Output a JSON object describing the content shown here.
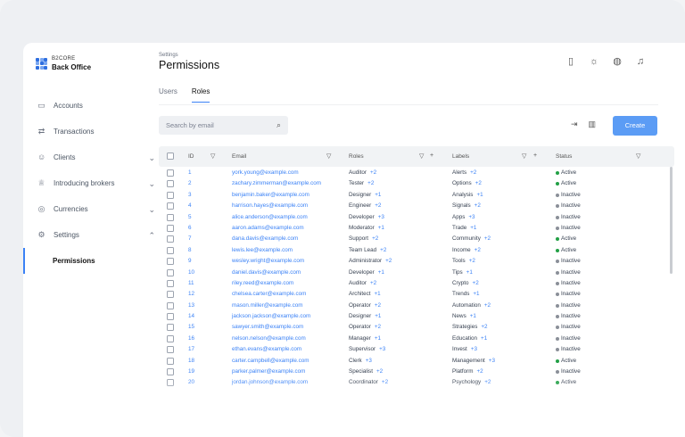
{
  "brand": {
    "line1": "B2CORE",
    "line2": "Back Office",
    "accent": "#2f6fe0"
  },
  "sidebar": {
    "items": [
      {
        "label": "Accounts",
        "icon": "wallet-icon",
        "glyph": "▭",
        "chevron": ""
      },
      {
        "label": "Transactions",
        "icon": "arrows-icon",
        "glyph": "⇄",
        "chevron": ""
      },
      {
        "label": "Clients",
        "icon": "users-icon",
        "glyph": "☺",
        "chevron": "⌄"
      },
      {
        "label": "Introducing brokers",
        "icon": "trophy-icon",
        "glyph": "♕",
        "chevron": "⌄"
      },
      {
        "label": "Currencies",
        "icon": "coin-icon",
        "glyph": "◎",
        "chevron": "⌄"
      },
      {
        "label": "Settings",
        "icon": "gear-icon",
        "glyph": "⚙",
        "chevron": "⌃"
      }
    ],
    "sub_active": "Permissions"
  },
  "header": {
    "breadcrumb": "Settings",
    "title": "Permissions",
    "icons": [
      "document-icon",
      "sun-icon",
      "globe-icon",
      "bell-icon"
    ]
  },
  "tabs": [
    {
      "label": "Users",
      "active": false
    },
    {
      "label": "Roles",
      "active": true
    }
  ],
  "search": {
    "placeholder": "Search by email"
  },
  "create_label": "Create",
  "columns": {
    "id": "ID",
    "email": "Email",
    "roles": "Roles",
    "labels": "Labels",
    "status": "Status"
  },
  "status_colors": {
    "Active": "#22a046",
    "Inactive": "#8a8f98"
  },
  "rows": [
    {
      "id": "1",
      "email": "york.young@example.com",
      "role": "Auditor",
      "role_more": "+2",
      "label": "Alerts",
      "label_more": "+2",
      "status": "Active"
    },
    {
      "id": "2",
      "email": "zachary.zimmerman@example.com",
      "role": "Tester",
      "role_more": "+2",
      "label": "Options",
      "label_more": "+2",
      "status": "Active"
    },
    {
      "id": "3",
      "email": "benjamin.baker@example.com",
      "role": "Designer",
      "role_more": "+1",
      "label": "Analysis",
      "label_more": "+1",
      "status": "Inactive"
    },
    {
      "id": "4",
      "email": "harrison.hayes@example.com",
      "role": "Engineer",
      "role_more": "+2",
      "label": "Signals",
      "label_more": "+2",
      "status": "Inactive"
    },
    {
      "id": "5",
      "email": "alice.anderson@example.com",
      "role": "Developer",
      "role_more": "+3",
      "label": "Apps",
      "label_more": "+3",
      "status": "Inactive"
    },
    {
      "id": "6",
      "email": "aaron.adams@example.com",
      "role": "Moderator",
      "role_more": "+1",
      "label": "Trade",
      "label_more": "+1",
      "status": "Inactive"
    },
    {
      "id": "7",
      "email": "dana.davis@example.com",
      "role": "Support",
      "role_more": "+2",
      "label": "Community",
      "label_more": "+2",
      "status": "Active"
    },
    {
      "id": "8",
      "email": "lewis.lee@example.com",
      "role": "Team Lead",
      "role_more": "+2",
      "label": "Income",
      "label_more": "+2",
      "status": "Active"
    },
    {
      "id": "9",
      "email": "wesley.wright@example.com",
      "role": "Administrator",
      "role_more": "+2",
      "label": "Tools",
      "label_more": "+2",
      "status": "Inactive"
    },
    {
      "id": "10",
      "email": "daniel.davis@example.com",
      "role": "Developer",
      "role_more": "+1",
      "label": "Tips",
      "label_more": "+1",
      "status": "Inactive"
    },
    {
      "id": "11",
      "email": "riley.reed@example.com",
      "role": "Auditor",
      "role_more": "+2",
      "label": "Crypto",
      "label_more": "+2",
      "status": "Inactive"
    },
    {
      "id": "12",
      "email": "chelsea.carter@example.com",
      "role": "Architect",
      "role_more": "+1",
      "label": "Trends",
      "label_more": "+1",
      "status": "Inactive"
    },
    {
      "id": "13",
      "email": "mason.miller@example.com",
      "role": "Operator",
      "role_more": "+2",
      "label": "Automation",
      "label_more": "+2",
      "status": "Inactive"
    },
    {
      "id": "14",
      "email": "jackson.jackson@example.com",
      "role": "Designer",
      "role_more": "+1",
      "label": "News",
      "label_more": "+1",
      "status": "Inactive"
    },
    {
      "id": "15",
      "email": "sawyer.smith@example.com",
      "role": "Operator",
      "role_more": "+2",
      "label": "Strategies",
      "label_more": "+2",
      "status": "Inactive"
    },
    {
      "id": "16",
      "email": "nelson.nelson@example.com",
      "role": "Manager",
      "role_more": "+1",
      "label": "Education",
      "label_more": "+1",
      "status": "Inactive"
    },
    {
      "id": "17",
      "email": "ethan.evans@example.com",
      "role": "Supervisor",
      "role_more": "+3",
      "label": "Invest",
      "label_more": "+3",
      "status": "Inactive"
    },
    {
      "id": "18",
      "email": "carter.campbell@example.com",
      "role": "Clerk",
      "role_more": "+3",
      "label": "Management",
      "label_more": "+3",
      "status": "Active"
    },
    {
      "id": "19",
      "email": "parker.palmer@example.com",
      "role": "Specialist",
      "role_more": "+2",
      "label": "Platform",
      "label_more": "+2",
      "status": "Inactive"
    },
    {
      "id": "20",
      "email": "jordan.johnson@example.com",
      "role": "Coordinator",
      "role_more": "+2",
      "label": "Psychology",
      "label_more": "+2",
      "status": "Active"
    }
  ]
}
